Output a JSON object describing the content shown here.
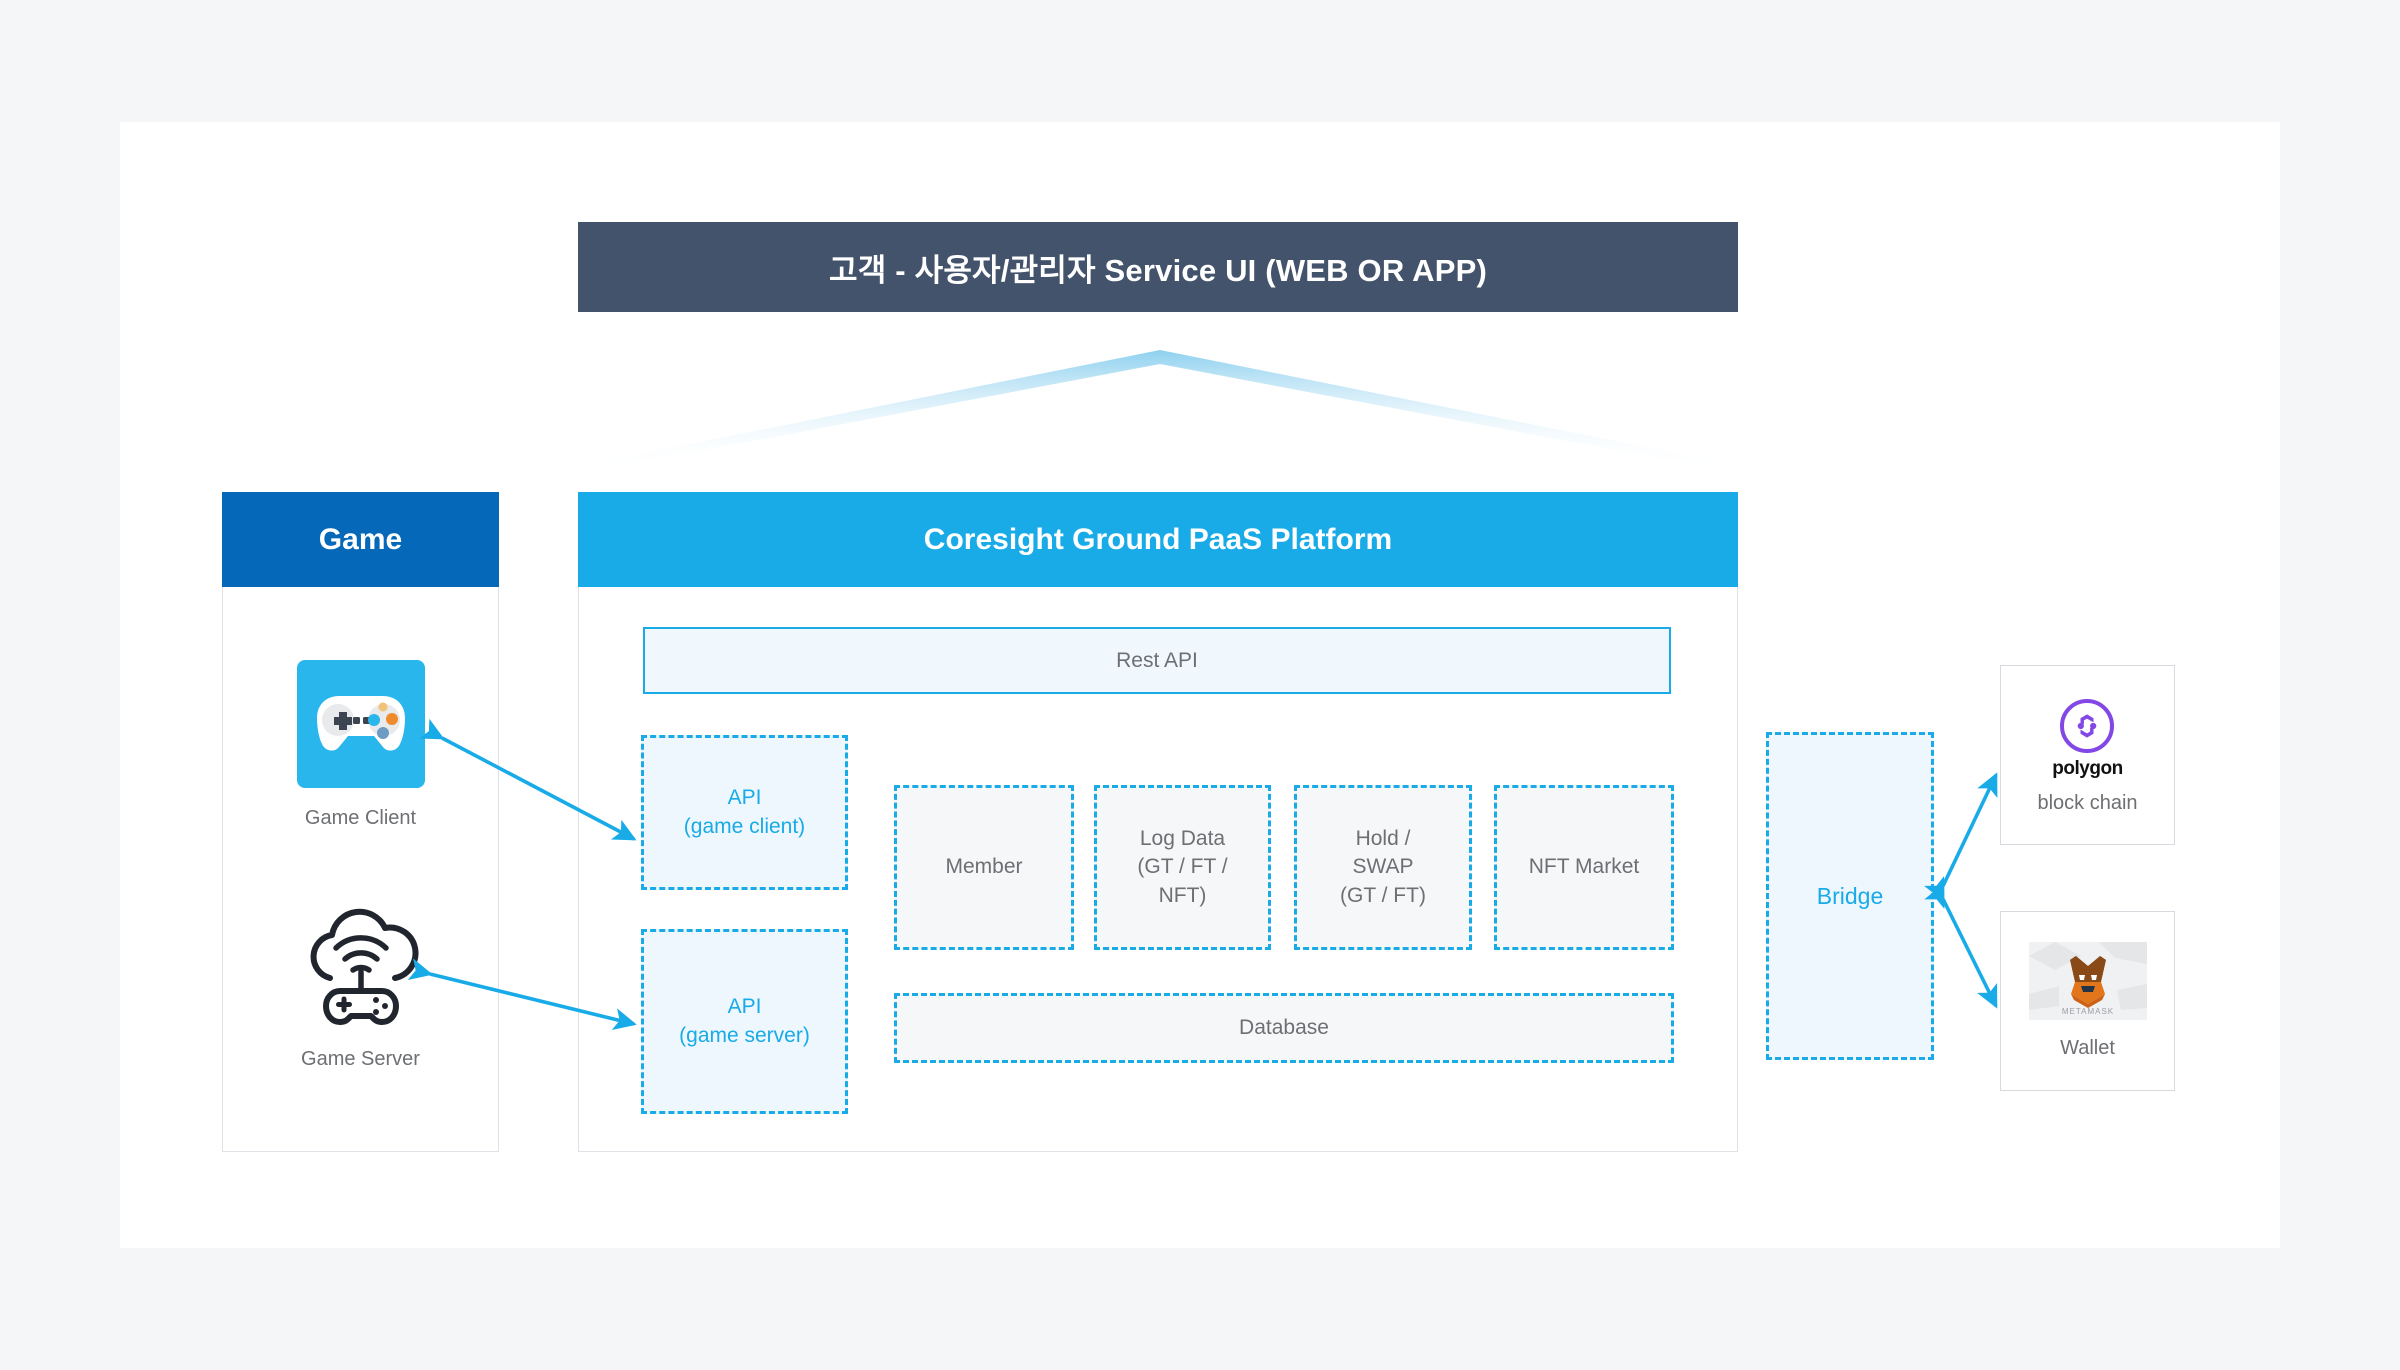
{
  "theme": {
    "page_bg": "#f4f6f8",
    "card_bg": "#ffffff",
    "banner_bg": "#44536c",
    "game_header_bg": "#0568b8",
    "platform_header_bg": "#18abe8",
    "accent_blue": "#18abe8",
    "dashed_fill_blue": "#eef7fd",
    "dashed_fill_grey": "#f6f7f8",
    "text_grey": "#6d6f73",
    "polygon_purple": "#8247e5",
    "metamask_orange": "#e2761b"
  },
  "service_banner": {
    "title": "고객 - 사용자/관리자 Service UI (WEB OR APP)"
  },
  "game_panel": {
    "header": "Game",
    "nodes": [
      {
        "id": "game-client",
        "caption": "Game Client",
        "icon": "gamepad-icon"
      },
      {
        "id": "game-server",
        "caption": "Game Server",
        "icon": "cloud-gaming-icon"
      }
    ]
  },
  "platform": {
    "header": "Coresight Ground PaaS Platform",
    "rest_api": "Rest API",
    "api_boxes": [
      {
        "id": "api-client",
        "line1": "API",
        "line2": "(game client)"
      },
      {
        "id": "api-server",
        "line1": "API",
        "line2": "(game server)"
      }
    ],
    "modules": [
      {
        "id": "member",
        "label": "Member"
      },
      {
        "id": "logdata",
        "label": "Log Data\n(GT / FT /\nNFT)"
      },
      {
        "id": "hold",
        "label": "Hold /\nSWAP\n(GT / FT)"
      },
      {
        "id": "nft",
        "label": "NFT Market"
      }
    ],
    "database": "Database"
  },
  "bridge": {
    "label": "Bridge"
  },
  "external": [
    {
      "id": "blockchain",
      "caption": "block chain",
      "logo_text": "polygon",
      "icon": "polygon-logo-icon"
    },
    {
      "id": "wallet",
      "caption": "Wallet",
      "logo_text": "METAMASK",
      "icon": "metamask-fox-icon"
    }
  ],
  "connectors": [
    {
      "id": "game-client-to-api-client",
      "type": "double-arrow"
    },
    {
      "id": "game-server-to-api-server",
      "type": "double-arrow"
    },
    {
      "id": "bridge-to-blockchain",
      "type": "double-arrow"
    },
    {
      "id": "bridge-to-wallet",
      "type": "double-arrow"
    }
  ]
}
